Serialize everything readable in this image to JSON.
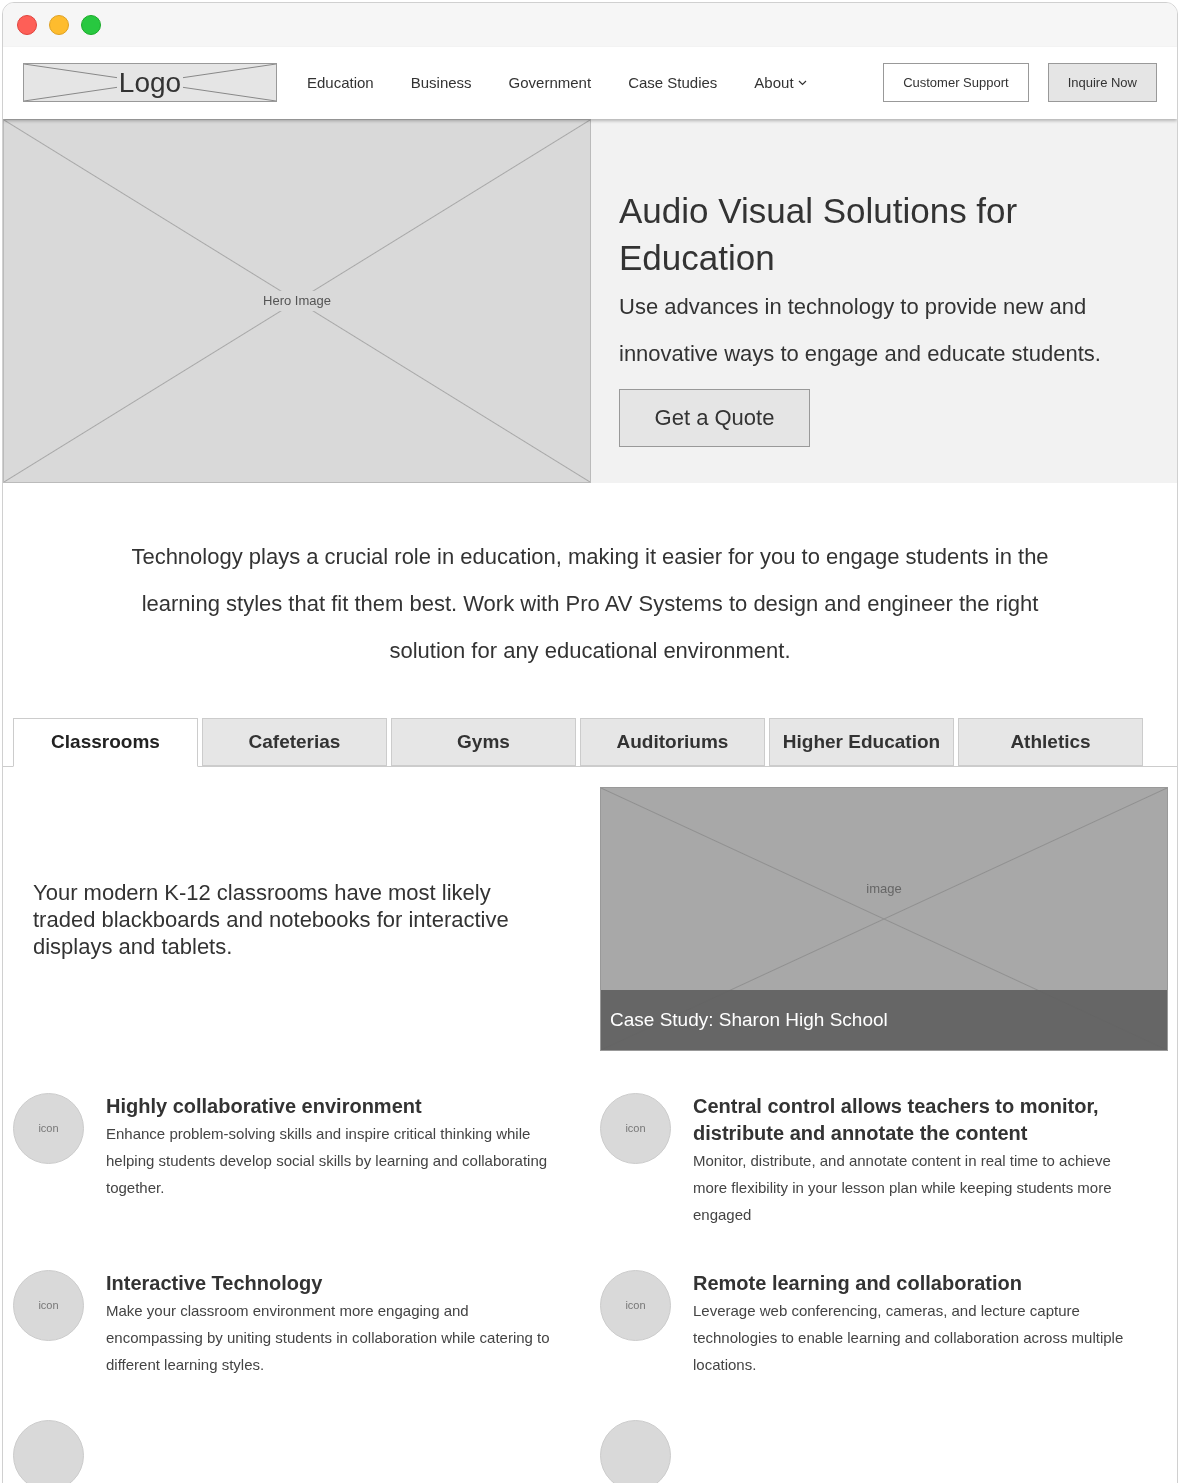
{
  "nav": {
    "logo": "Logo",
    "links": [
      {
        "label": "Education",
        "dropdown": false
      },
      {
        "label": "Business",
        "dropdown": false
      },
      {
        "label": "Government",
        "dropdown": false
      },
      {
        "label": "Case Studies",
        "dropdown": false
      },
      {
        "label": "About",
        "dropdown": true
      }
    ],
    "buttons": [
      {
        "label": "Customer Support",
        "kind": "outline"
      },
      {
        "label": "Inquire Now",
        "kind": "filled"
      }
    ]
  },
  "hero": {
    "image_label": "Hero Image",
    "title": "Audio Visual Solutions for Education",
    "subtitle": "Use advances in technology to provide new and innovative ways to engage and educate students.",
    "button": "Get a Quote"
  },
  "intro": "Technology plays a crucial role in education, making it easier for you to engage students in the learning styles that fit them best. Work with Pro AV Systems to design and engineer the right solution for any educational environment.",
  "tabs": [
    {
      "label": "Classrooms",
      "selected": true
    },
    {
      "label": "Cafeterias",
      "selected": false
    },
    {
      "label": "Gyms",
      "selected": false
    },
    {
      "label": "Auditoriums",
      "selected": false
    },
    {
      "label": "Higher Education",
      "selected": false
    },
    {
      "label": "Athletics",
      "selected": false
    }
  ],
  "panel": {
    "text": "Your modern K-12 classrooms have most likely traded blackboards and notebooks for interactive displays and tablets.",
    "image_label": "image",
    "caption": "Case Study: Sharon High School"
  },
  "features": [
    {
      "icon": "icon",
      "title": "Highly collaborative environment",
      "text": "Enhance problem-solving skills and inspire critical thinking while helping students develop social skills by learning and collaborating together."
    },
    {
      "icon": "icon",
      "title": "Central control allows teachers to monitor, distribute and annotate the content",
      "text": "Monitor, distribute, and annotate content in real time to achieve more flexibility in your lesson plan while keeping students more engaged"
    },
    {
      "icon": "icon",
      "title": "Interactive Technology",
      "text": "Make your classroom environment more engaging and encompassing by uniting students in collaboration while catering to different learning styles."
    },
    {
      "icon": "icon",
      "title": "Remote learning and collaboration",
      "text": "Leverage web conferencing, cameras, and lecture capture technologies to enable learning and collaboration across multiple locations."
    }
  ]
}
